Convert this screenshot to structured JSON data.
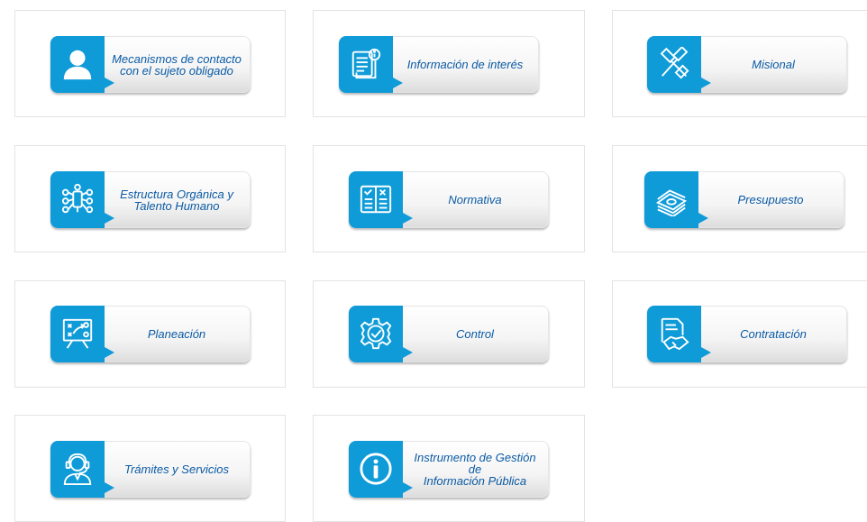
{
  "brand_color": "#0f9bd8",
  "label_color": "#0a5aa5",
  "tiles": [
    {
      "id": "mecanismos",
      "icon": "user-icon",
      "label": "Mecanismos de contacto\ncon el sujeto obligado"
    },
    {
      "id": "informacion",
      "icon": "document-info-icon",
      "label": "Información de interés"
    },
    {
      "id": "misional",
      "icon": "gavel-icon",
      "label": "Misional"
    },
    {
      "id": "estructura",
      "icon": "org-chart-icon",
      "label": "Estructura Orgánica y\nTalento Humano"
    },
    {
      "id": "normativa",
      "icon": "checklist-book-icon",
      "label": "Normativa"
    },
    {
      "id": "presupuesto",
      "icon": "money-stack-icon",
      "label": "Presupuesto"
    },
    {
      "id": "planeacion",
      "icon": "strategy-board-icon",
      "label": "Planeación"
    },
    {
      "id": "control",
      "icon": "gear-check-icon",
      "label": "Control"
    },
    {
      "id": "contratacion",
      "icon": "contract-handshake-icon",
      "label": "Contratación"
    },
    {
      "id": "tramites",
      "icon": "agent-headset-icon",
      "label": "Trámites y Servicios"
    },
    {
      "id": "instrumento",
      "icon": "info-circle-icon",
      "label": "Instrumento de Gestión de\nInformación Pública"
    }
  ]
}
